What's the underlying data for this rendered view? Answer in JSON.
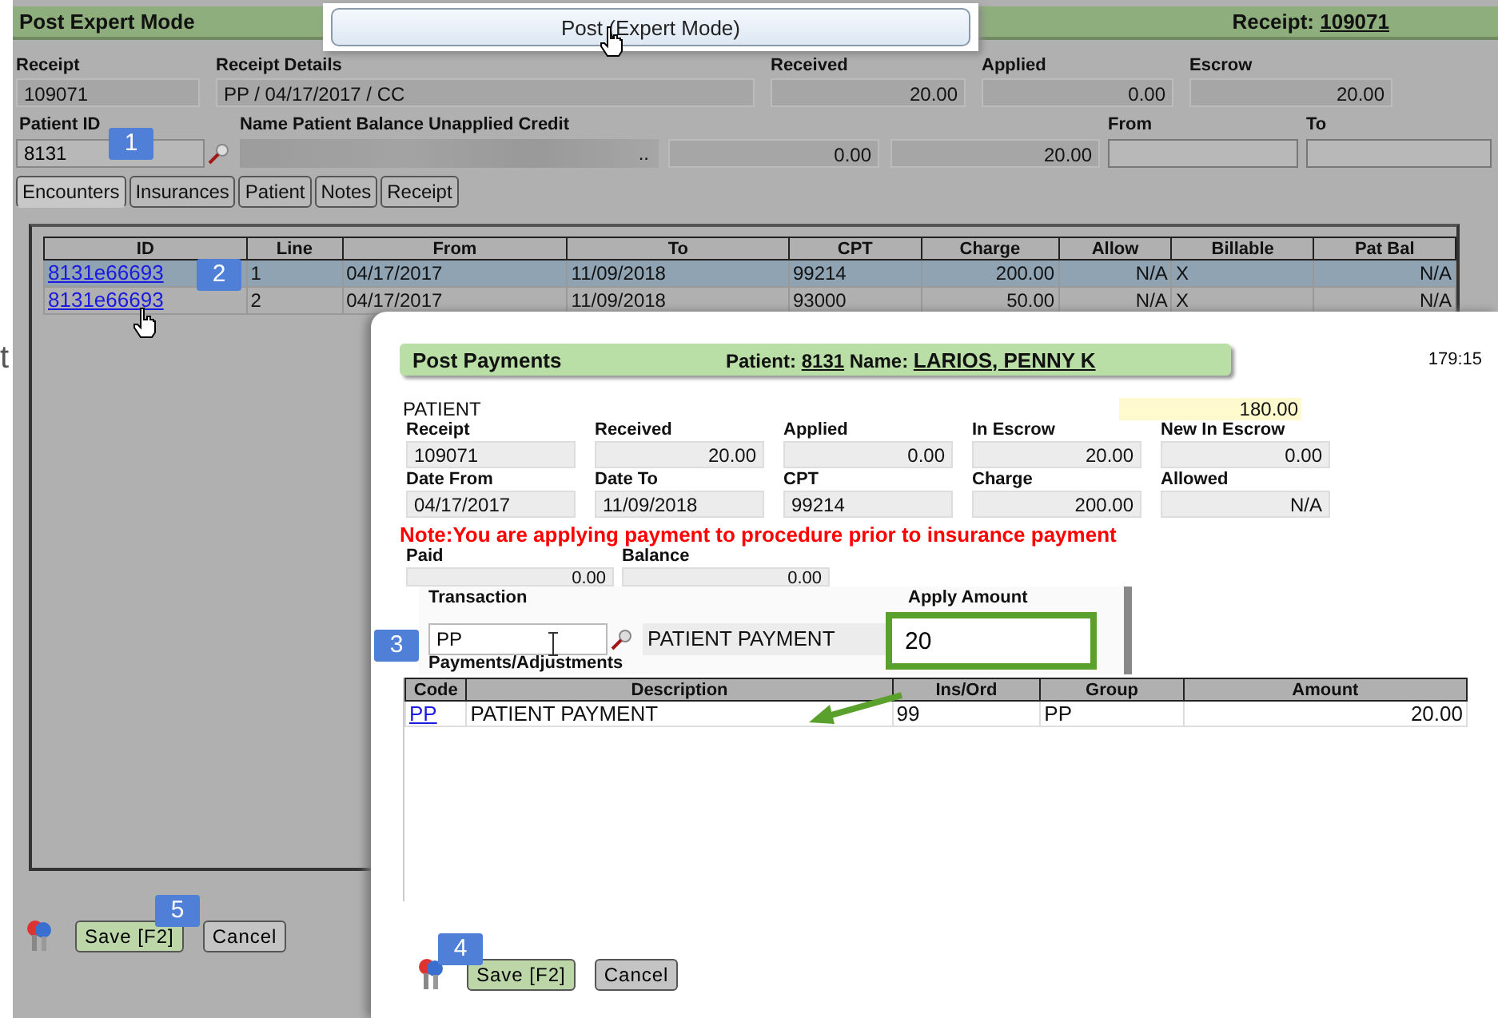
{
  "edge_text": "t",
  "main": {
    "title": "Post Expert Mode",
    "receipt_label": "Receipt:",
    "receipt_number": "109071",
    "row1": [
      {
        "label": "Receipt",
        "value": "109071"
      },
      {
        "label": "Receipt Details",
        "value": "PP / 04/17/2017 / CC"
      },
      {
        "label": "Received",
        "value": "20.00"
      },
      {
        "label": "Applied",
        "value": "0.00"
      },
      {
        "label": "Escrow",
        "value": "20.00"
      }
    ],
    "patient_id": {
      "label": "Patient ID",
      "value": "8131"
    },
    "name_label": "Name Patient Balance Unapplied Credit",
    "name_field": {
      "value": "..",
      "blurred": true
    },
    "balance": "0.00",
    "unapplied_credit": "20.00",
    "from": {
      "label": "From"
    },
    "to": {
      "label": "To"
    },
    "tabs": [
      {
        "label": "Encounters",
        "selected": true
      },
      {
        "label": "Insurances",
        "selected": false
      },
      {
        "label": "Patient",
        "selected": false
      },
      {
        "label": "Notes",
        "selected": false
      },
      {
        "label": "Receipt",
        "selected": false
      }
    ],
    "table": {
      "columns": [
        "ID",
        "Line",
        "From",
        "To",
        "CPT",
        "Charge",
        "Allow",
        "Billable",
        "Pat Bal"
      ],
      "rows": [
        {
          "selected": true,
          "cells": [
            "8131e66693",
            "1",
            "04/17/2017",
            "11/09/2018",
            "99214",
            "200.00",
            "N/A",
            "X",
            "N/A"
          ]
        },
        {
          "selected": false,
          "cells": [
            "8131e66693",
            "2",
            "04/17/2017",
            "11/09/2018",
            "93000",
            "50.00",
            "N/A",
            "X",
            "N/A"
          ]
        }
      ]
    },
    "buttons": [
      {
        "label": "Save [F2]",
        "kind": "primary"
      },
      {
        "label": "Cancel",
        "kind": "plain"
      }
    ]
  },
  "popup_button": "Post (Expert Mode)",
  "dialog": {
    "title": "Post Payments",
    "patient_label": "Patient:",
    "patient_id": "8131",
    "name_label": "Name:",
    "name": "LARIOS, PENNY K",
    "time": "179:15",
    "payer": "PATIENT",
    "payer_amount": "180.00",
    "grid": [
      {
        "label": "Receipt",
        "value": "109071"
      },
      {
        "label": "Received",
        "value": "20.00"
      },
      {
        "label": "Applied",
        "value": "0.00"
      },
      {
        "label": "In Escrow",
        "value": "20.00"
      },
      {
        "label": "New In Escrow",
        "value": "0.00"
      },
      {
        "label": "Date From",
        "value": "04/17/2017"
      },
      {
        "label": "Date To",
        "value": "11/09/2018"
      },
      {
        "label": "CPT",
        "value": "99214"
      },
      {
        "label": "Charge",
        "value": "200.00"
      },
      {
        "label": "Allowed",
        "value": "N/A"
      }
    ],
    "note": "Note:You are applying payment to procedure prior to insurance payment",
    "paid": {
      "label": "Paid",
      "value": "0.00"
    },
    "balance": {
      "label": "Balance",
      "value": "0.00"
    },
    "transaction": {
      "label": "Transaction",
      "value": "PP",
      "description": "PATIENT PAYMENT"
    },
    "apply_amount": {
      "label": "Apply Amount",
      "value": "20",
      "highlighted": true
    },
    "payments_label": "Payments/Adjustments",
    "table": {
      "columns": [
        "Code",
        "Description",
        "Ins/Ord",
        "Group",
        "Amount"
      ],
      "rows": [
        {
          "cells": [
            "PP",
            "PATIENT PAYMENT",
            "99",
            "PP",
            "20.00"
          ]
        }
      ]
    },
    "buttons": [
      {
        "label": "Save [F2]",
        "kind": "primary"
      },
      {
        "label": "Cancel",
        "kind": "plain"
      }
    ]
  },
  "badges": [
    "1",
    "2",
    "3",
    "4",
    "5"
  ]
}
